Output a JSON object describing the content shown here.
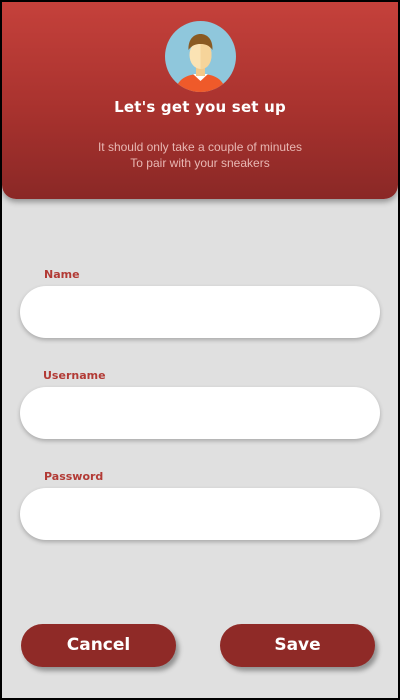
{
  "header": {
    "title": "Let's get you set up",
    "subtitle_line1": "It should only take a couple of minutes",
    "subtitle_line2": "To pair with your sneakers",
    "avatar_icon": "user-avatar-icon"
  },
  "form": {
    "name": {
      "label": "Name",
      "value": "",
      "placeholder": ""
    },
    "username": {
      "label": "Username",
      "value": "",
      "placeholder": ""
    },
    "password": {
      "label": "Password",
      "value": "",
      "placeholder": ""
    }
  },
  "actions": {
    "cancel_label": "Cancel",
    "save_label": "Save"
  },
  "colors": {
    "accent": "#b23a35",
    "header_top": "#c5413b",
    "header_bottom": "#8a2826",
    "button": "#8f2a27",
    "background": "#e0e0e0"
  }
}
